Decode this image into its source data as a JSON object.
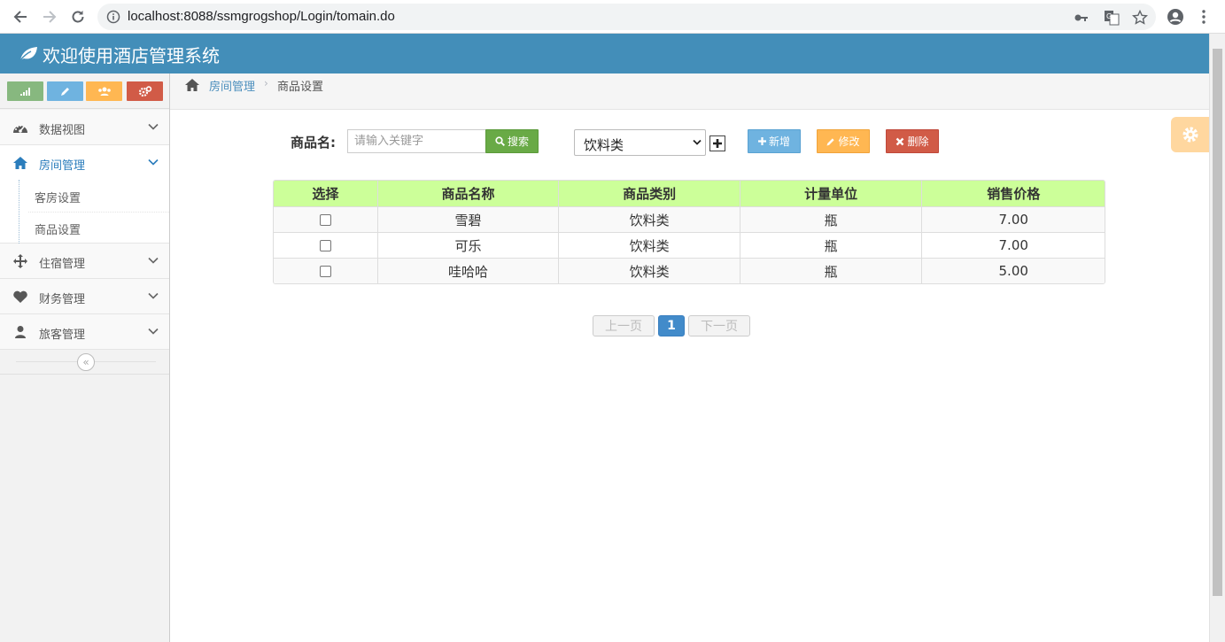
{
  "browser": {
    "url": "localhost:8088/ssmgrogshop/Login/tomain.do"
  },
  "app": {
    "title": "欢迎使用酒店管理系统",
    "brand_color": "#438eb9"
  },
  "sidebar": {
    "shortcuts": [
      {
        "icon": "signal-icon",
        "color": "#87b87f"
      },
      {
        "icon": "pencil-icon",
        "color": "#6fb3e0"
      },
      {
        "icon": "users-icon",
        "color": "#ffb752"
      },
      {
        "icon": "cogs-icon",
        "color": "#d15b47"
      }
    ],
    "items": [
      {
        "label": "数据视图",
        "icon": "dashboard-icon"
      },
      {
        "label": "房间管理",
        "icon": "home-icon",
        "active": true
      },
      {
        "label": "住宿管理",
        "icon": "move-icon"
      },
      {
        "label": "财务管理",
        "icon": "heart-icon"
      },
      {
        "label": "旅客管理",
        "icon": "user-icon"
      }
    ],
    "subitems": [
      {
        "label": "客房设置"
      },
      {
        "label": "商品设置"
      }
    ]
  },
  "breadcrumb": {
    "parent": "房间管理",
    "current": "商品设置"
  },
  "toolbar": {
    "name_label": "商品名:",
    "search_placeholder": "请输入关键字",
    "search_button": "搜索",
    "category_selected": "饮料类",
    "add_button": "新增",
    "edit_button": "修改",
    "delete_button": "删除"
  },
  "table": {
    "headers": [
      "选择",
      "商品名称",
      "商品类别",
      "计量单位",
      "销售价格"
    ],
    "rows": [
      {
        "name": "雪碧",
        "category": "饮料类",
        "unit": "瓶",
        "price": "7.00"
      },
      {
        "name": "可乐",
        "category": "饮料类",
        "unit": "瓶",
        "price": "7.00"
      },
      {
        "name": "哇哈哈",
        "category": "饮料类",
        "unit": "瓶",
        "price": "5.00"
      }
    ]
  },
  "pagination": {
    "prev": "上一页",
    "current": "1",
    "next": "下一页"
  }
}
